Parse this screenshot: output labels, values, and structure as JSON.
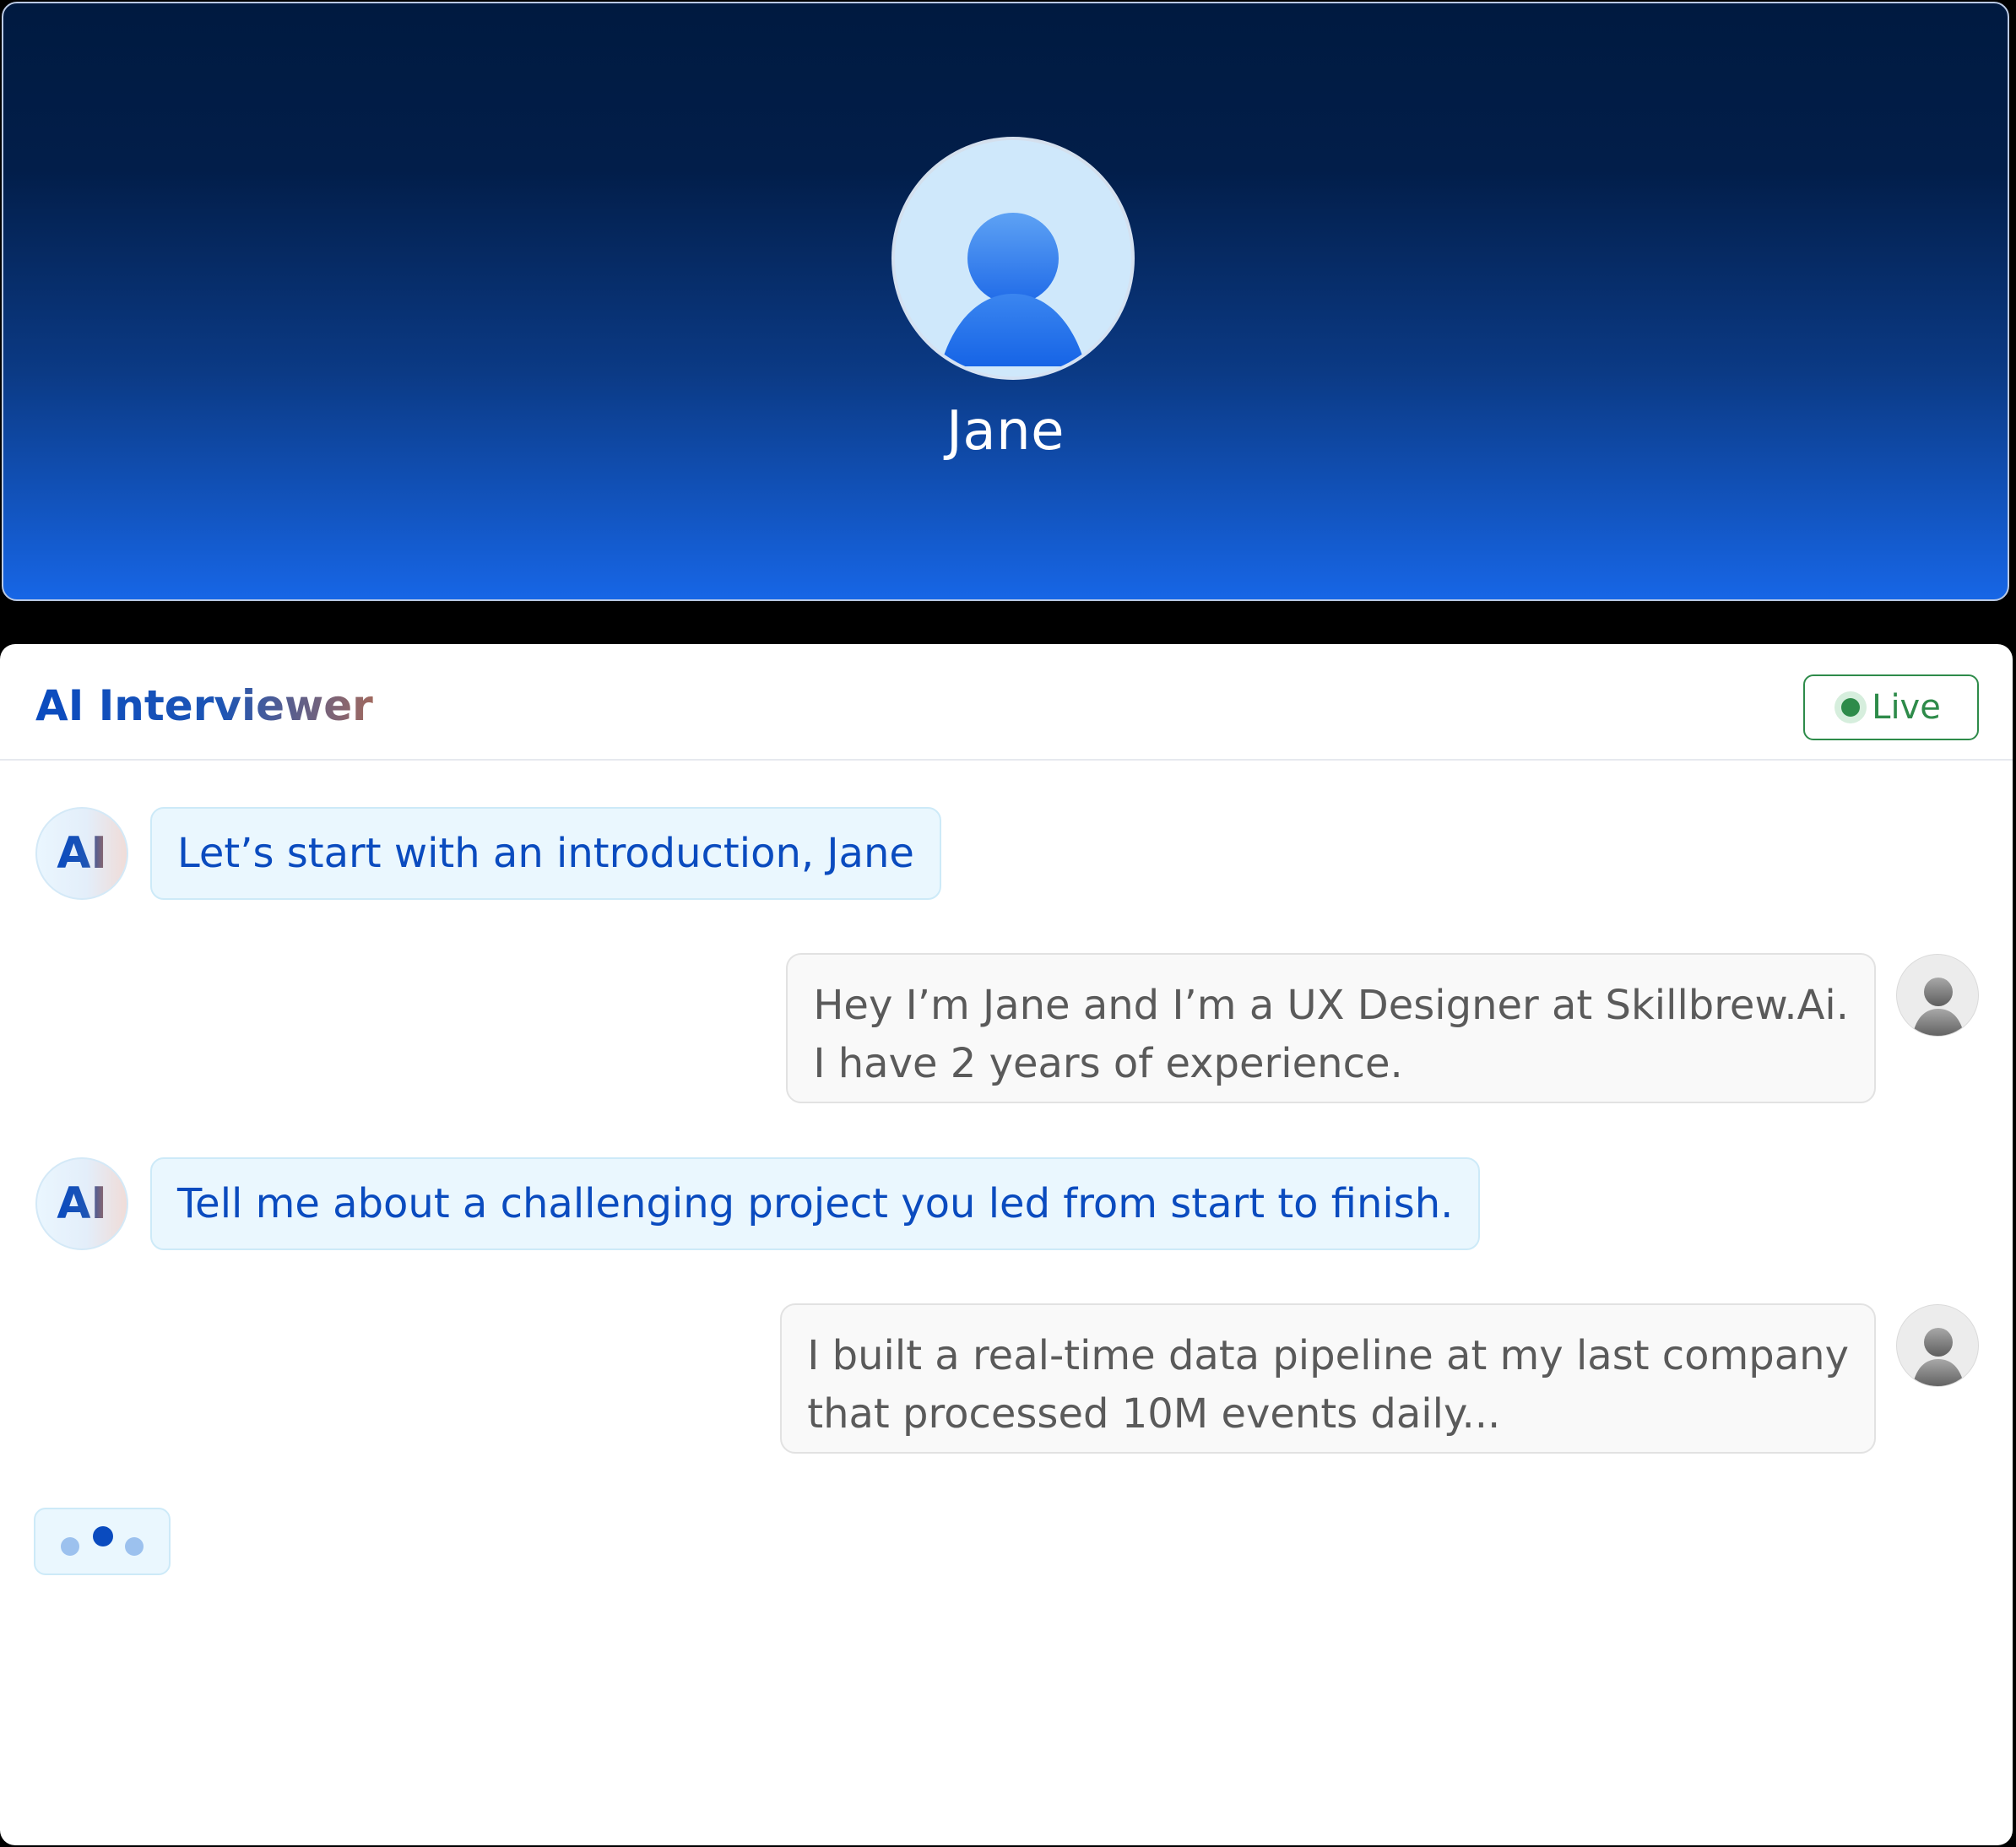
{
  "participant": {
    "name": "Jane"
  },
  "chat": {
    "title": "AI Interviewer",
    "status": "Live",
    "ai_badge": "AI",
    "messages": [
      {
        "from": "ai",
        "lines": [
          "Let’s start with an introduction, Jane"
        ]
      },
      {
        "from": "user",
        "lines": [
          "Hey I’m Jane and I’m a UX Designer at Skillbrew.Ai.",
          "I have 2 years of experience."
        ]
      },
      {
        "from": "ai",
        "lines": [
          "Tell me about a challenging project you led from start to finish."
        ]
      },
      {
        "from": "user",
        "lines": [
          "I built a real-time data pipeline at my last company",
          "that processed 10M events daily..."
        ]
      }
    ],
    "typing_indicator": true
  },
  "colors": {
    "accent": "#0a4bbf",
    "live_green": "#2e8b4a",
    "video_gradient_top": "#001a40",
    "video_gradient_bottom": "#1766e6",
    "ai_bubble_bg": "#eaf7fe",
    "user_bubble_bg": "#f9f9f9"
  },
  "icons": [
    "user-avatar-icon",
    "live-dot-icon",
    "ai-avatar-icon",
    "typing-dots-icon"
  ]
}
